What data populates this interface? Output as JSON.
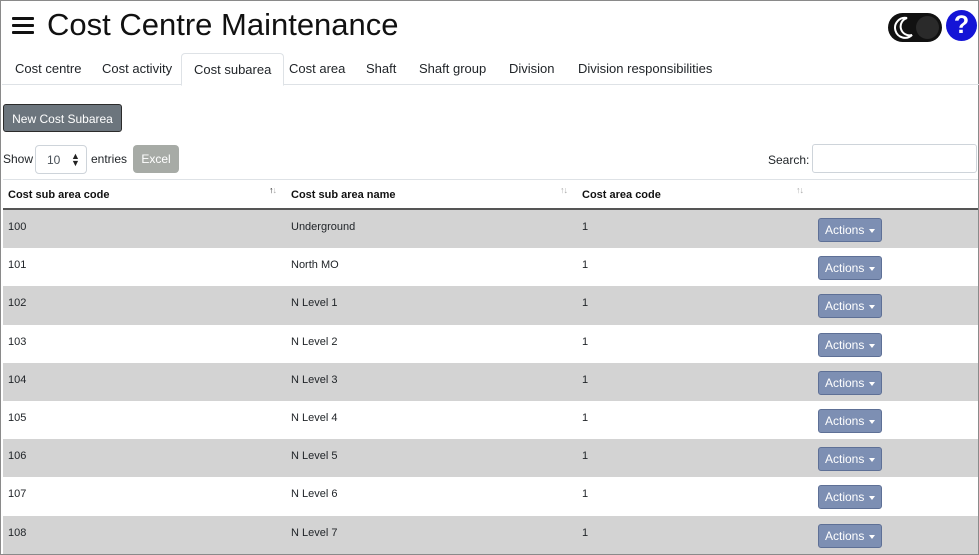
{
  "header": {
    "title": "Cost Centre Maintenance",
    "menu_icon": "hamburger-icon",
    "theme_icon": "moon-icon",
    "help_label": "?"
  },
  "tabs": [
    {
      "label": "Cost centre",
      "active": false
    },
    {
      "label": "Cost activity",
      "active": false
    },
    {
      "label": "Cost subarea",
      "active": true
    },
    {
      "label": "Cost area",
      "active": false
    },
    {
      "label": "Shaft",
      "active": false
    },
    {
      "label": "Shaft group",
      "active": false
    },
    {
      "label": "Division",
      "active": false
    },
    {
      "label": "Division responsibilities",
      "active": false
    }
  ],
  "toolbar": {
    "new_label": "New Cost Subarea",
    "show_label": "Show",
    "page_length": "10",
    "entries_label": "entries",
    "excel_label": "Excel",
    "search_label": "Search:",
    "search_value": ""
  },
  "table": {
    "columns": [
      {
        "label": "Cost sub area code",
        "sort": "asc"
      },
      {
        "label": "Cost sub area name",
        "sort": "none"
      },
      {
        "label": "Cost area code",
        "sort": "none"
      },
      {
        "label": "",
        "sort": "none"
      }
    ],
    "sort_icon": "↑↓",
    "action_label": "Actions",
    "rows": [
      {
        "code": "100",
        "name": "Underground",
        "area": "1"
      },
      {
        "code": "101",
        "name": "North MO",
        "area": "1"
      },
      {
        "code": "102",
        "name": "N Level 1",
        "area": "1"
      },
      {
        "code": "103",
        "name": "N Level 2",
        "area": "1"
      },
      {
        "code": "104",
        "name": "N Level 3",
        "area": "1"
      },
      {
        "code": "105",
        "name": "N Level 4",
        "area": "1"
      },
      {
        "code": "106",
        "name": "N Level 5",
        "area": "1"
      },
      {
        "code": "107",
        "name": "N Level 6",
        "area": "1"
      },
      {
        "code": "108",
        "name": "N Level 7",
        "area": "1"
      }
    ]
  },
  "colors": {
    "stripe": "#d3d3d3",
    "actions_button": "#7d8fb3",
    "new_button": "#6c757d",
    "excel_button": "#a7aba6",
    "help_button": "#1414d6",
    "toggle": "#111111"
  }
}
